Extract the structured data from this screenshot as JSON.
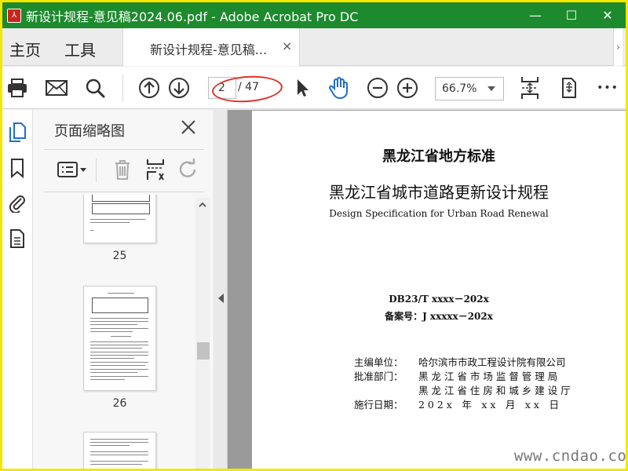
{
  "titlebar": {
    "title": "新设计规程-意见稿2024.06.pdf - Adobe Acrobat Pro DC",
    "color": "#1d8a2d",
    "minimize": "—",
    "maximize": "☐",
    "close": "✕"
  },
  "menu": {
    "home": "主页",
    "tools": "工具"
  },
  "tab": {
    "label": "新设计规程-意见稿...",
    "close": "×"
  },
  "toolbar": {
    "current_page": "2",
    "total_pages": "/ 47",
    "zoom": "66.7%",
    "more": "•••",
    "annotation_color": "#e0302a"
  },
  "panel": {
    "title": "页面缩略图",
    "thumbnails": [
      "25",
      "26"
    ]
  },
  "document": {
    "standard_type": "黑龙江省地方标准",
    "title_cn": "黑龙江省城市道路更新设计规程",
    "title_en": "Design Specification for Urban Road Renewal",
    "code": "DB23/T xxxx－202x",
    "record": "备案号：J xxxxx－202x",
    "editor_label": "主编单位：",
    "editor_value": "哈尔滨市市政工程设计院有限公司",
    "approver_label": "批准部门：",
    "approver_value_1": "黑 龙 江 省 市 场 监 督 管 理 局",
    "approver_value_2": "黑 龙 江 省 住 房 和 城 乡 建 设 厅",
    "date_label": "施行日期：",
    "date_value": "2 0 2 x　年　x x　月　x x　日"
  },
  "watermark": "www.cndao.com",
  "icons": [
    "pdf-app-icon",
    "print-icon",
    "email-icon",
    "search-icon",
    "page-up-icon",
    "page-down-icon",
    "select-cursor-icon",
    "hand-tool-icon",
    "zoom-out-icon",
    "zoom-in-icon",
    "fit-page-icon",
    "rotate-page-icon",
    "page-thumbnails-icon",
    "bookmark-icon",
    "attachment-icon",
    "document-icon",
    "close-icon",
    "thumbnail-options-icon",
    "delete-icon",
    "insert-page-icon",
    "redo-icon"
  ]
}
